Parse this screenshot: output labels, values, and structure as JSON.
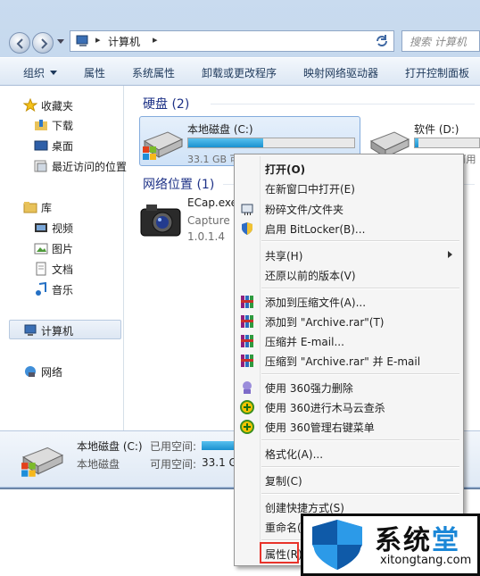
{
  "addressbar": {
    "crumb": "计算机"
  },
  "search": {
    "placeholder": "搜索 计算机"
  },
  "toolbar": {
    "items": [
      "组织",
      "属性",
      "系统属性",
      "卸载或更改程序",
      "映射网络驱动器",
      "打开控制面板"
    ]
  },
  "nav": {
    "favorites": "收藏夹",
    "downloads": "下载",
    "desktop": "桌面",
    "recent": "最近访问的位置",
    "libraries": "库",
    "videos": "视频",
    "pictures": "图片",
    "documents": "文档",
    "music": "音乐",
    "computer": "计算机",
    "network": "网络"
  },
  "main": {
    "hdd_group": "硬盘 (2)",
    "net_group": "网络位置 (1)",
    "drives": [
      {
        "name": "本地磁盘 (C:)",
        "free_text": "33.1 GB 可用，共 60.0 GB",
        "used_fraction": 0.45
      },
      {
        "name": "软件 (D:)",
        "free_text": "50.1 GB 可用",
        "used_fraction": 0.05
      }
    ],
    "app": {
      "name": "ECap.exe",
      "desc": "Capture",
      "version": "1.0.1.4"
    }
  },
  "details": {
    "name": "本地磁盘 (C:)",
    "type": "本地磁盘",
    "used_label": "已用空间:",
    "free_label": "可用空间:",
    "free_value": "33.1 GB"
  },
  "context_menu": {
    "open": "打开(O)",
    "open_new": "在新窗口中打开(E)",
    "shred": "粉碎文件/文件夹",
    "bitlocker": "启用 BitLocker(B)...",
    "share": "共享(H)",
    "restore": "还原以前的版本(V)",
    "add_archive": "添加到压缩文件(A)...",
    "add_rar": "添加到 \"Archive.rar\"(T)",
    "compress_email": "压缩并 E-mail...",
    "compress_rar_email": "压缩到 \"Archive.rar\" 并 E-mail",
    "delete360": "使用 360强力删除",
    "scan360": "使用 360进行木马云查杀",
    "menu360": "使用 360管理右键菜单",
    "format": "格式化(A)...",
    "copy": "复制(C)",
    "shortcut": "创建快捷方式(S)",
    "rename": "重命名(M)",
    "properties": "属性(R)"
  },
  "watermark": {
    "title_black": "系统",
    "title_blue": "堂",
    "url": "xitongtang.com"
  },
  "colors": {
    "accent": "#1e3287",
    "highlight": "#e8332a",
    "bar": "#26a0da"
  }
}
